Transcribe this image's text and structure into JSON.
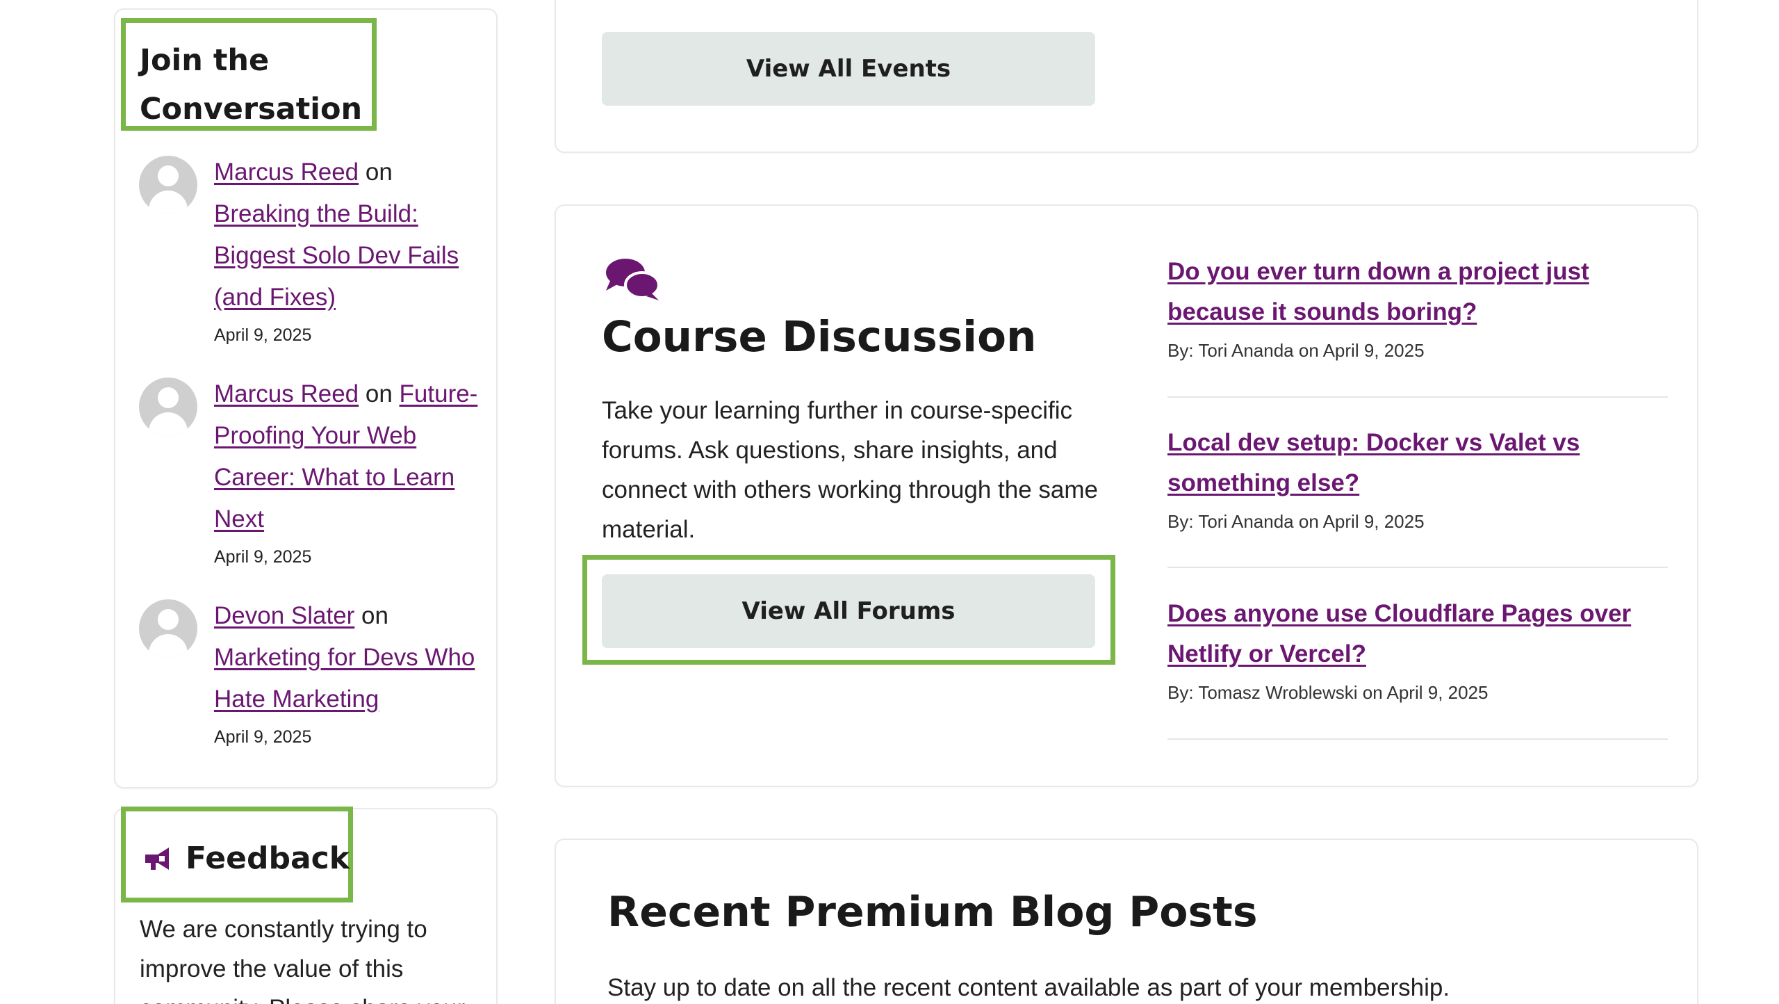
{
  "sidebar": {
    "conversation": {
      "title_line1": "Join the",
      "title_line2": "Conversation",
      "items": [
        {
          "author": "Marcus Reed",
          "on": " on ",
          "post": "Breaking the Build: Biggest Solo Dev Fails (and Fixes)",
          "date": "April 9, 2025"
        },
        {
          "author": "Marcus Reed",
          "on": " on ",
          "post": "Future-Proofing Your Web Career: What to Learn Next",
          "date": "April 9, 2025"
        },
        {
          "author": "Devon Slater",
          "on": " on ",
          "post": "Marketing for Devs Who Hate Marketing",
          "date": "April 9, 2025"
        }
      ]
    },
    "feedback": {
      "title": "Feedback",
      "text": "We are constantly trying to improve the value of this community. Please share your"
    }
  },
  "events": {
    "button_label": "View All Events"
  },
  "course_discussion": {
    "title": "Course Discussion",
    "description": "Take your learning further in course-specific forums. Ask questions, share insights, and connect with others working through the same material.",
    "button_label": "View All Forums",
    "topics": [
      {
        "title": "Do you ever turn down a project just because it sounds boring?",
        "meta": "By: Tori Ananda on April 9, 2025"
      },
      {
        "title": "Local dev setup: Docker vs Valet vs something else?",
        "meta": "By: Tori Ananda on April 9, 2025"
      },
      {
        "title": "Does anyone use Cloudflare Pages over Netlify or Vercel?",
        "meta": "By: Tomasz Wroblewski on April 9, 2025"
      }
    ]
  },
  "premium_posts": {
    "title": "Recent Premium Blog Posts",
    "subtitle": "Stay up to date on all the recent content available as part of your membership."
  },
  "colors": {
    "link": "#6b1772",
    "highlight": "#7ab648",
    "button_bg": "#e1e8e5"
  }
}
